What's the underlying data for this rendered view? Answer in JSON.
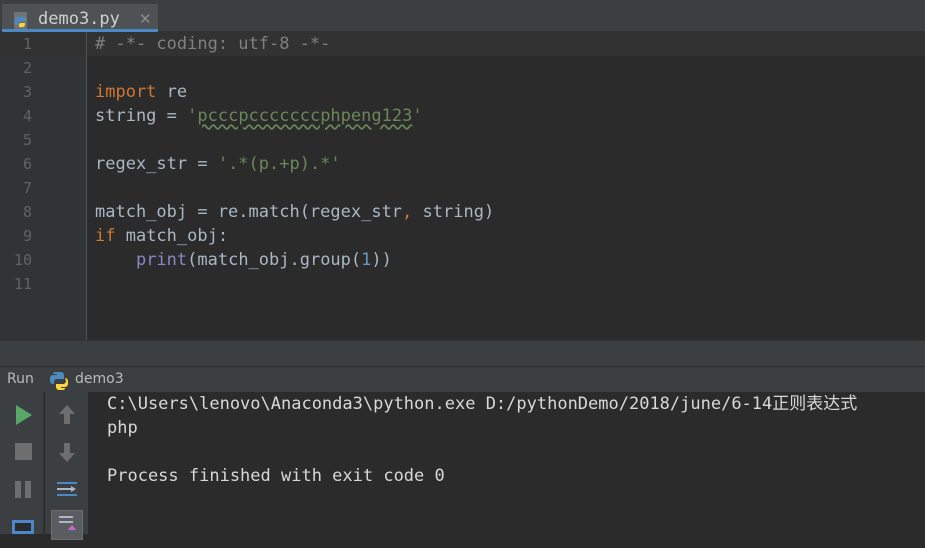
{
  "tab": {
    "filename": "demo3.py",
    "close_glyph": "✕"
  },
  "editor": {
    "line_numbers": [
      "1",
      "2",
      "3",
      "4",
      "5",
      "6",
      "7",
      "8",
      "9",
      "10",
      "11"
    ],
    "lines": {
      "l1": "# -*- coding: utf-8 -*-",
      "l3_kw": "import",
      "l3_rest": " re",
      "l4_a": "string = ",
      "l4_q1": "'",
      "l4_str": "pcccpcccccccphpeng123",
      "l4_q2": "'",
      "l6_a": "regex_str = ",
      "l6_str": "'.*(p.+p).*'",
      "l8": "match_obj = re.match(regex_str",
      "l8_comma": ",",
      "l8_b": " string)",
      "l9_kw": "if",
      "l9_rest": " match_obj:",
      "l10_indent": "    ",
      "l10_bi": "print",
      "l10_a": "(match_obj.group(",
      "l10_num": "1",
      "l10_b": "))"
    }
  },
  "run_panel": {
    "label": "Run",
    "config_name": "demo3",
    "output": {
      "cmd": "C:\\Users\\lenovo\\Anaconda3\\python.exe D:/pythonDemo/2018/june/6-14正则表达式",
      "result": "php",
      "finished": "Process finished with exit code 0"
    }
  },
  "colors": {
    "run_green": "#59a869",
    "stop_gray": "#6e6e6e",
    "accent_blue": "#4a88c7"
  }
}
